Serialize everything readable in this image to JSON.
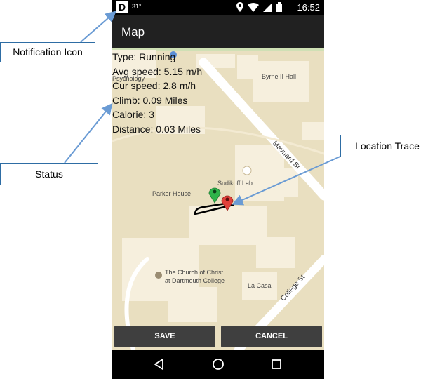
{
  "status_bar": {
    "logo": "D",
    "temperature": "31°",
    "time": "16:52",
    "icons": [
      "location-icon",
      "wifi-icon",
      "signal-icon",
      "battery-icon"
    ]
  },
  "app_bar": {
    "title": "Map"
  },
  "status": {
    "type": "Type: Running",
    "avg_speed": "Avg speed: 5.15 m/h",
    "cur_speed": "Cur speed: 2.8 m/h",
    "climb": "Climb: 0.09 Miles",
    "calorie": "Calorie: 3",
    "distance": "Distance: 0.03 Miles"
  },
  "map": {
    "labels": {
      "psychology": "Psychology",
      "byrne": "Byrne II Hall",
      "maynard": "Maynard St",
      "sudikoff": "Sudikoff Lab",
      "parker": "Parker House",
      "church_1": "The Church of Christ",
      "church_2": "at Dartmouth College",
      "la_casa": "La Casa",
      "college": "College St"
    },
    "markers": [
      {
        "name": "start-marker",
        "color": "#2fb34a"
      },
      {
        "name": "end-marker",
        "color": "#e0413a"
      }
    ],
    "colors": {
      "background": "#e9dfc0",
      "building": "#f6efdd",
      "road": "#ffffff",
      "trace": "#000000"
    }
  },
  "buttons": {
    "save": "SAVE",
    "cancel": "CANCEL"
  },
  "annotations": {
    "notification_icon": "Notification Icon",
    "status": "Status",
    "location_trace": "Location Trace"
  },
  "colors": {
    "app_bar": "#212121",
    "status_bar": "#000000",
    "button": "#3f3f3f",
    "callout_border": "#2e6da4",
    "arrow": "#6a9bd4"
  }
}
